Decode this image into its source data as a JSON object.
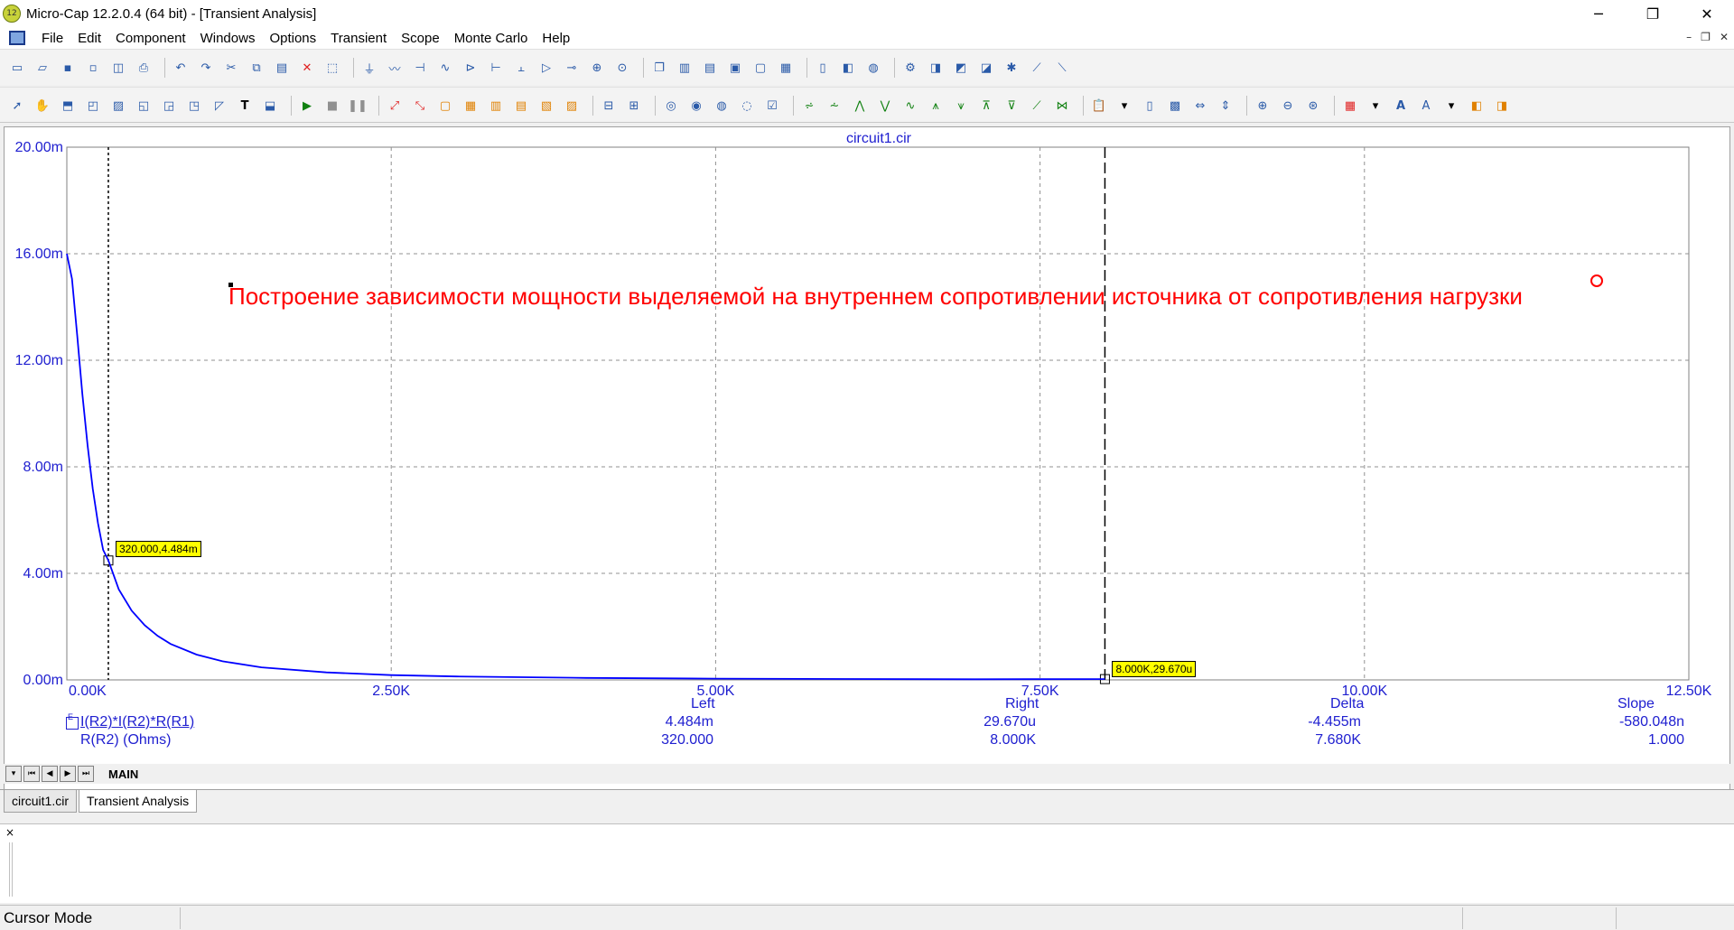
{
  "window": {
    "title": "Micro-Cap 12.2.0.4 (64 bit) - [Transient Analysis]",
    "icon_text": "12",
    "minimize": "─",
    "maximize": "❐",
    "close": "✕"
  },
  "menu": {
    "items": [
      "File",
      "Edit",
      "Component",
      "Windows",
      "Options",
      "Transient",
      "Scope",
      "Monte Carlo",
      "Help"
    ],
    "mdi_controls": [
      "–",
      "❐",
      "✕"
    ]
  },
  "plot": {
    "title": "circuit1.cir",
    "annotation": "Построение зависимости мощности выделяемой на внутреннем сопротивлении источника от сопротивления нагрузки"
  },
  "chart_data": {
    "type": "line",
    "x_ticks": [
      "0.00K",
      "2.50K",
      "5.00K",
      "7.50K",
      "10.00K",
      "12.50K"
    ],
    "y_ticks": [
      "0.00m",
      "4.00m",
      "8.00m",
      "12.00m",
      "16.00m",
      "20.00m"
    ],
    "xlim": [
      0,
      12500
    ],
    "ylim": [
      0,
      0.02
    ],
    "grid": true,
    "series": [
      {
        "name": "I(R2)*I(R2)*R(R1)",
        "color": "#0000ff",
        "x": [
          0,
          40,
          80,
          120,
          160,
          200,
          240,
          280,
          320,
          400,
          500,
          600,
          700,
          800,
          1000,
          1200,
          1500,
          2000,
          2500,
          3000,
          4000,
          5000,
          6000,
          7000,
          8000
        ],
        "y": [
          0.016,
          0.01506,
          0.01293,
          0.01073,
          0.0088,
          0.00718,
          0.00588,
          0.00488,
          0.004484,
          0.0034,
          0.0026,
          0.00205,
          0.00165,
          0.00135,
          0.00095,
          0.0007,
          0.00047,
          0.00028,
          0.00018,
          0.000128,
          7.4e-05,
          4.8e-05,
          3.4e-05,
          2.5e-05,
          2.97e-05
        ]
      }
    ],
    "cursors": [
      {
        "x": 320,
        "y": 0.004484,
        "label": "320.000,4.484m",
        "style": "dotted"
      },
      {
        "x": 8000,
        "y": 2.97e-05,
        "label": "8.000K,29.670u",
        "style": "dashed"
      }
    ]
  },
  "readout": {
    "headers": {
      "left": "Left",
      "right": "Right",
      "delta": "Delta",
      "slope": "Slope"
    },
    "rows": [
      {
        "label": "I(R2)*I(R2)*R(R1)",
        "left": "4.484m",
        "right": "29.670u",
        "delta": "-4.455m",
        "slope": "-580.048n"
      },
      {
        "label": "R(R2) (Ohms)",
        "left": "320.000",
        "right": "8.000K",
        "delta": "7.680K",
        "slope": "1.000"
      }
    ],
    "legend_box": "E"
  },
  "page_tabs": {
    "main": "MAIN"
  },
  "doc_tabs": [
    "circuit1.cir",
    "Transient Analysis"
  ],
  "output": {
    "close": "×"
  },
  "status": {
    "mode": "Cursor Mode"
  }
}
